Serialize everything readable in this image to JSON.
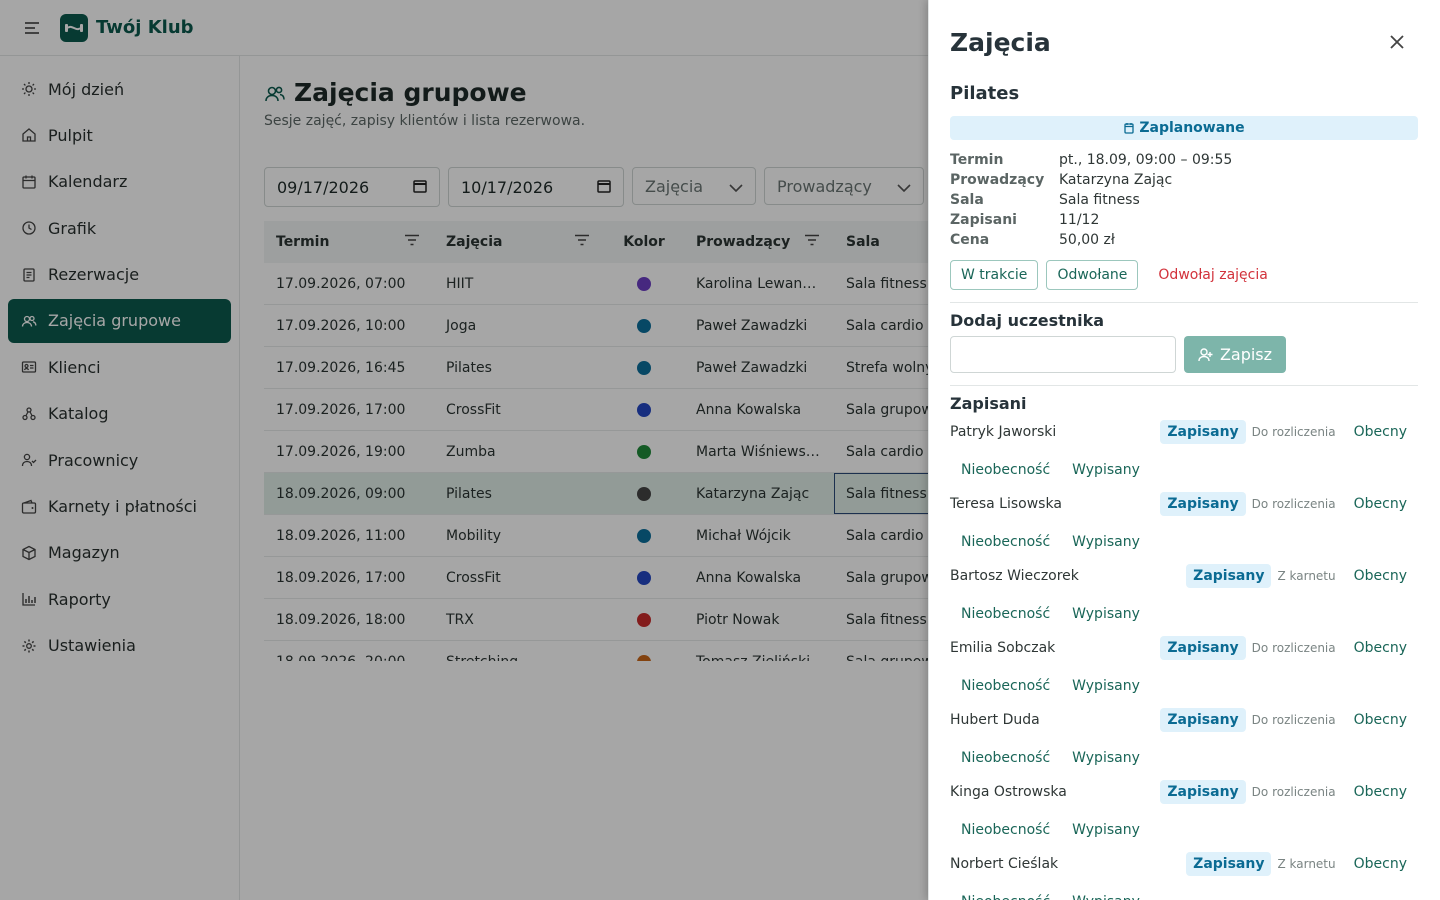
{
  "app": {
    "title": "Twój Klub"
  },
  "sidebar": {
    "items": [
      {
        "label": "Mój dzień",
        "icon": "sun-icon"
      },
      {
        "label": "Pulpit",
        "icon": "home-icon"
      },
      {
        "label": "Kalendarz",
        "icon": "calendar-icon"
      },
      {
        "label": "Grafik",
        "icon": "clock-icon"
      },
      {
        "label": "Rezerwacje",
        "icon": "document-icon"
      },
      {
        "label": "Zajęcia grupowe",
        "icon": "group-icon",
        "active": true
      },
      {
        "label": "Klienci",
        "icon": "id-card-icon"
      },
      {
        "label": "Katalog",
        "icon": "catalog-icon"
      },
      {
        "label": "Pracownicy",
        "icon": "staff-icon"
      },
      {
        "label": "Karnety i płatności",
        "icon": "wallet-icon"
      },
      {
        "label": "Magazyn",
        "icon": "box-icon"
      },
      {
        "label": "Raporty",
        "icon": "bar-chart-icon"
      },
      {
        "label": "Ustawienia",
        "icon": "gear-icon"
      }
    ]
  },
  "page": {
    "title": "Zajęcia grupowe",
    "subtitle": "Sesje zajęć, zapisy klientów i lista rezerwowa."
  },
  "filters": {
    "date_from": "09/17/2026",
    "date_to": "10/17/2026",
    "class_placeholder": "Zajęcia",
    "instructor_placeholder": "Prowadzący"
  },
  "table": {
    "headers": {
      "term": "Termin",
      "class": "Zajęcia",
      "color": "Kolor",
      "instructor": "Prowadzący",
      "room": "Sala"
    },
    "rows": [
      {
        "term": "17.09.2026, 07:00",
        "class": "HIIT",
        "color": "#6c3ec4",
        "instructor": "Karolina Lewan…",
        "room": "Sala fitness"
      },
      {
        "term": "17.09.2026, 10:00",
        "class": "Joga",
        "color": "#0c6f9c",
        "instructor": "Paweł Zawadzki",
        "room": "Sala cardio"
      },
      {
        "term": "17.09.2026, 16:45",
        "class": "Pilates",
        "color": "#0c6f9c",
        "instructor": "Paweł Zawadzki",
        "room": "Strefa wolny"
      },
      {
        "term": "17.09.2026, 17:00",
        "class": "CrossFit",
        "color": "#2447c4",
        "instructor": "Anna Kowalska",
        "room": "Sala grupow"
      },
      {
        "term": "17.09.2026, 19:00",
        "class": "Zumba",
        "color": "#1f8a3a",
        "instructor": "Marta Wiśniews…",
        "room": "Sala cardio"
      },
      {
        "term": "18.09.2026, 09:00",
        "class": "Pilates",
        "color": "#444444",
        "instructor": "Katarzyna Zając",
        "room": "Sala fitness",
        "selected": true
      },
      {
        "term": "18.09.2026, 11:00",
        "class": "Mobility",
        "color": "#0c6f9c",
        "instructor": "Michał Wójcik",
        "room": "Sala cardio"
      },
      {
        "term": "18.09.2026, 17:00",
        "class": "CrossFit",
        "color": "#2447c4",
        "instructor": "Anna Kowalska",
        "room": "Sala grupow"
      },
      {
        "term": "18.09.2026, 18:00",
        "class": "TRX",
        "color": "#c92b2b",
        "instructor": "Piotr Nowak",
        "room": "Sala fitness"
      },
      {
        "term": "18.09.2026, 20:00",
        "class": "Stretching",
        "color": "#c9681a",
        "instructor": "Tomasz Zieliński",
        "room": "Sala grupow"
      }
    ]
  },
  "drawer": {
    "title": "Zajęcia",
    "class_name": "Pilates",
    "status": "Zaplanowane",
    "details": [
      {
        "label": "Termin",
        "value": "pt., 18.09, 09:00 – 09:55"
      },
      {
        "label": "Prowadzący",
        "value": "Katarzyna Zając"
      },
      {
        "label": "Sala",
        "value": "Sala fitness"
      },
      {
        "label": "Zapisani",
        "value": "11/12"
      },
      {
        "label": "Cena",
        "value": "50,00 zł"
      }
    ],
    "actions": {
      "in_progress": "W trakcie",
      "cancelled": "Odwołane",
      "cancel_class": "Odwołaj zajęcia"
    },
    "add_section": {
      "title": "Dodaj uczestnika",
      "input_value": "",
      "button": "Zapisz"
    },
    "participants_title": "Zapisani",
    "participants": [
      {
        "name": "Patryk Jaworski",
        "status": "Zapisany",
        "billing": "Do rozliczenia"
      },
      {
        "name": "Teresa Lisowska",
        "status": "Zapisany",
        "billing": "Do rozliczenia"
      },
      {
        "name": "Bartosz Wieczorek",
        "status": "Zapisany",
        "billing": "Z karnetu"
      },
      {
        "name": "Emilia Sobczak",
        "status": "Zapisany",
        "billing": "Do rozliczenia"
      },
      {
        "name": "Hubert Duda",
        "status": "Zapisany",
        "billing": "Do rozliczenia"
      },
      {
        "name": "Kinga Ostrowska",
        "status": "Zapisany",
        "billing": "Do rozliczenia"
      },
      {
        "name": "Norbert Cieślak",
        "status": "Zapisany",
        "billing": "Z karnetu"
      }
    ],
    "participant_actions": {
      "present": "Obecny",
      "absent": "Nieobecność",
      "remove": "Wypisany"
    }
  }
}
